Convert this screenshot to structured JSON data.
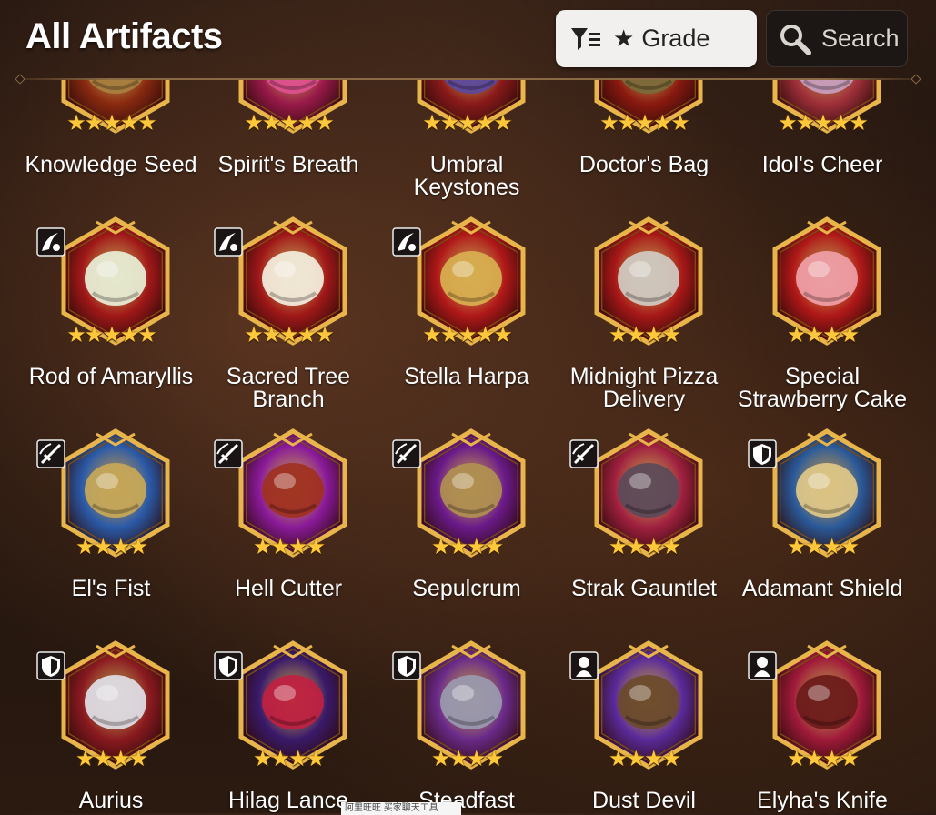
{
  "header": {
    "title": "All Artifacts"
  },
  "filter": {
    "label": "Grade",
    "star": "★"
  },
  "search": {
    "label": "Search"
  },
  "artifacts": [
    {
      "name": "Knowledge Seed",
      "stars": "★★★★★",
      "col": 0,
      "row": 0,
      "art": "#a88040",
      "bg": "#8a2a10"
    },
    {
      "name": "Spirit's Breath",
      "stars": "★★★★★",
      "col": 1,
      "row": 0,
      "art": "#e05090",
      "bg": "#9a1a4a"
    },
    {
      "name": "Umbral Keystones",
      "stars": "★★★★★",
      "col": 2,
      "row": 0,
      "art": "#5a4aa0",
      "bg": "#8a1a1a"
    },
    {
      "name": "Doctor's Bag",
      "stars": "★★★★★",
      "col": 3,
      "row": 0,
      "art": "#7a6a3a",
      "bg": "#8a1a10"
    },
    {
      "name": "Idol's Cheer",
      "stars": "★★★★★",
      "col": 4,
      "row": 0,
      "art": "#c8a0c0",
      "bg": "#a0303a"
    },
    {
      "name": "Rod of Amaryllis",
      "stars": "★★★★★",
      "col": 0,
      "row": 1,
      "art": "#e8f0d8",
      "bg": "#a01818",
      "badge": "dual"
    },
    {
      "name": "Sacred Tree Branch",
      "stars": "★★★★★",
      "col": 1,
      "row": 1,
      "art": "#f4efe0",
      "bg": "#a01818",
      "badge": "dual"
    },
    {
      "name": "Stella Harpa",
      "stars": "★★★★★",
      "col": 2,
      "row": 1,
      "art": "#d8b050",
      "bg": "#b01818",
      "badge": "dual"
    },
    {
      "name": "Midnight Pizza Delivery",
      "stars": "★★★★",
      "col": 3,
      "row": 1,
      "art": "#d0ccc4",
      "bg": "#a81818"
    },
    {
      "name": "Special Strawberry Cake",
      "stars": "★★★★",
      "col": 4,
      "row": 1,
      "art": "#f0a0a8",
      "bg": "#b01818"
    },
    {
      "name": "El's Fist",
      "stars": "★★★★",
      "col": 0,
      "row": 2,
      "art": "#c8a858",
      "bg": "#2a5aa8",
      "badge": "sword"
    },
    {
      "name": "Hell Cutter",
      "stars": "★★★★",
      "col": 1,
      "row": 2,
      "art": "#a03020",
      "bg": "#8a1a9a",
      "badge": "sword"
    },
    {
      "name": "Sepulcrum",
      "stars": "★★★★",
      "col": 2,
      "row": 2,
      "art": "#b09050",
      "bg": "#6a1a8a",
      "badge": "sword"
    },
    {
      "name": "Strak Gauntlet",
      "stars": "★★★★",
      "col": 3,
      "row": 2,
      "art": "#5a4a5a",
      "bg": "#a02040",
      "badge": "sword"
    },
    {
      "name": "Adamant Shield",
      "stars": "★★★★",
      "col": 4,
      "row": 2,
      "art": "#e0c888",
      "bg": "#2a5a9a",
      "badge": "shield"
    },
    {
      "name": "Aurius",
      "stars": "★★★★",
      "col": 0,
      "row": 3,
      "art": "#e0e0e8",
      "bg": "#8a1a20",
      "badge": "shield"
    },
    {
      "name": "Hilag Lance",
      "stars": "★★★★",
      "col": 1,
      "row": 3,
      "art": "#c02040",
      "bg": "#3a1a6a",
      "badge": "shield"
    },
    {
      "name": "Steadfast",
      "stars": "★★★★",
      "col": 2,
      "row": 3,
      "art": "#9a9ab0",
      "bg": "#6a2a8a",
      "badge": "shield"
    },
    {
      "name": "Dust Devil",
      "stars": "★★★★",
      "col": 3,
      "row": 3,
      "art": "#6a4a2a",
      "bg": "#5a2a9a",
      "badge": "thief"
    },
    {
      "name": "Elyha's Knife",
      "stars": "★★★★",
      "col": 4,
      "row": 3,
      "art": "#6a1a1a",
      "bg": "#a01a3a",
      "badge": "thief"
    }
  ],
  "watermark": {
    "text": "阿里旺旺 买家聊天工具"
  }
}
